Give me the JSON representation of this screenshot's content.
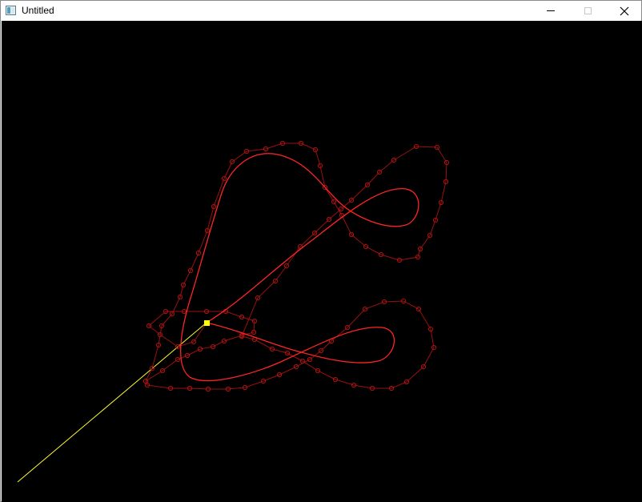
{
  "window": {
    "title": "Untitled",
    "controls": {
      "minimize": "minimize",
      "maximize": "maximize",
      "close": "close"
    }
  },
  "colors": {
    "titlebar_bg": "#ffffff",
    "canvas_bg": "#000000",
    "curve": "#ff2a2a",
    "control_polygon": "#a01010",
    "control_point": "#b01010",
    "tracer_line": "#ffff33",
    "tracer_point": "#ffff00"
  }
}
